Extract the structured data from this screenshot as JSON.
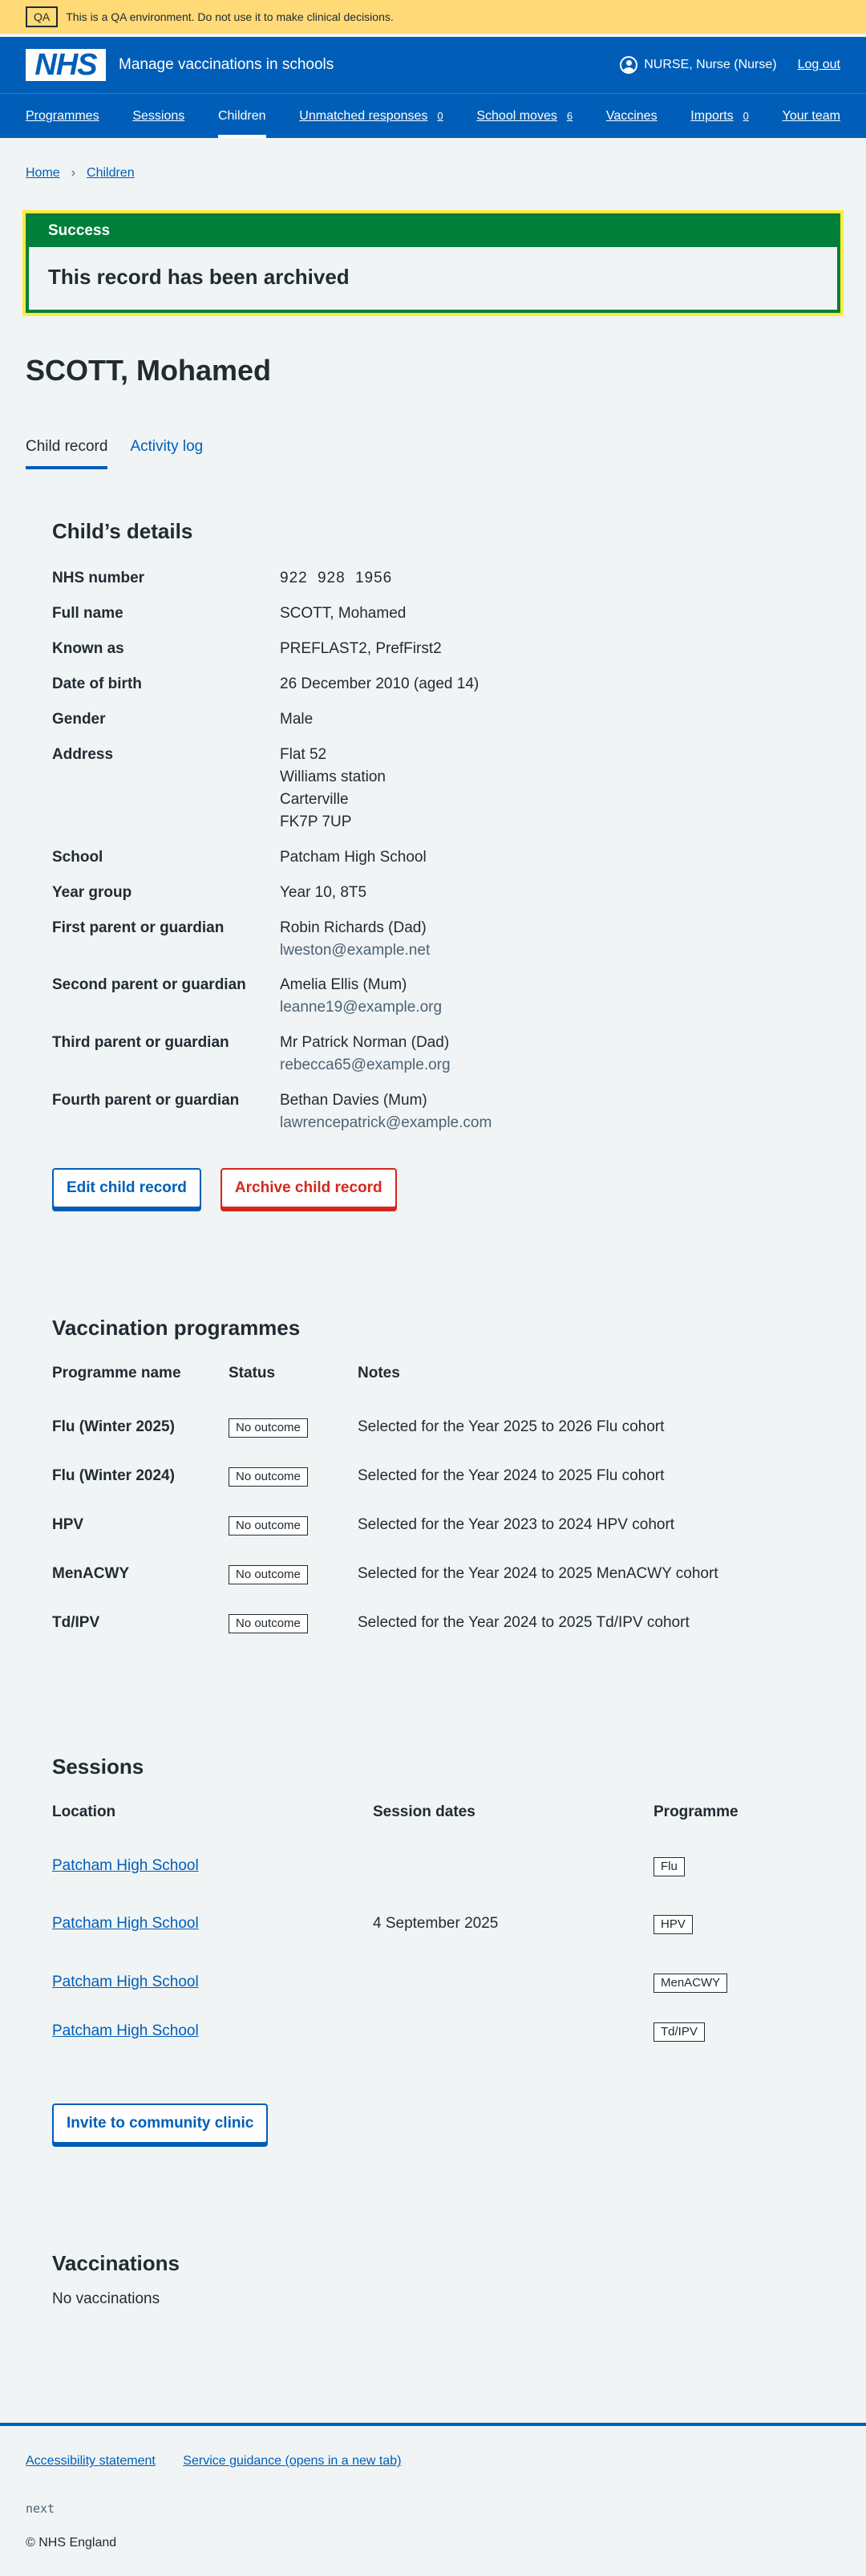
{
  "qa": {
    "tag": "QA",
    "message": "This is a QA environment. Do not use it to make clinical decisions."
  },
  "header": {
    "logo": "NHS",
    "service_name": "Manage vaccinations in schools",
    "user": "NURSE, Nurse (Nurse)",
    "logout": "Log out"
  },
  "nav": [
    {
      "label": "Programmes",
      "count": ""
    },
    {
      "label": "Sessions",
      "count": ""
    },
    {
      "label": "Children",
      "count": ""
    },
    {
      "label": "Unmatched responses",
      "count": "0"
    },
    {
      "label": "School moves",
      "count": "6"
    },
    {
      "label": "Vaccines",
      "count": ""
    },
    {
      "label": "Imports",
      "count": "0"
    },
    {
      "label": "Your team",
      "count": ""
    }
  ],
  "breadcrumb": {
    "home": "Home",
    "children": "Children"
  },
  "success": {
    "heading": "Success",
    "message": "This record has been archived"
  },
  "page_title": "SCOTT, Mohamed",
  "tabs": {
    "child_record": "Child record",
    "activity_log": "Activity log"
  },
  "details": {
    "heading": "Child’s details",
    "rows": [
      {
        "key": "NHS number",
        "value": "922 928 1956"
      },
      {
        "key": "Full name",
        "value": "SCOTT, Mohamed"
      },
      {
        "key": "Known as",
        "value": "PREFLAST2, PrefFirst2"
      },
      {
        "key": "Date of birth",
        "value": "26 December 2010 (aged 14)"
      },
      {
        "key": "Gender",
        "value": "Male"
      },
      {
        "key": "Address",
        "lines": [
          "Flat 52",
          "Williams station",
          "Carterville",
          "FK7P 7UP"
        ]
      },
      {
        "key": "School",
        "value": "Patcham High School"
      },
      {
        "key": "Year group",
        "value": "Year 10, 8T5"
      },
      {
        "key": "First parent or guardian",
        "value": "Robin Richards (Dad)",
        "sub": "lweston@example.net"
      },
      {
        "key": "Second parent or guardian",
        "value": "Amelia Ellis (Mum)",
        "sub": "leanne19@example.org"
      },
      {
        "key": "Third parent or guardian",
        "value": "Mr Patrick Norman (Dad)",
        "sub": "rebecca65@example.org"
      },
      {
        "key": "Fourth parent or guardian",
        "value": "Bethan Davies (Mum)",
        "sub": "lawrencepatrick@example.com"
      }
    ],
    "edit_button": "Edit child record",
    "archive_button": "Archive child record"
  },
  "programmes": {
    "heading": "Vaccination programmes",
    "columns": [
      "Programme name",
      "Status",
      "Notes"
    ],
    "rows": [
      {
        "name": "Flu (Winter 2025)",
        "status": "No outcome",
        "notes": "Selected for the Year 2025 to 2026 Flu cohort"
      },
      {
        "name": "Flu (Winter 2024)",
        "status": "No outcome",
        "notes": "Selected for the Year 2024 to 2025 Flu cohort"
      },
      {
        "name": "HPV",
        "status": "No outcome",
        "notes": "Selected for the Year 2023 to 2024 HPV cohort"
      },
      {
        "name": "MenACWY",
        "status": "No outcome",
        "notes": "Selected for the Year 2024 to 2025 MenACWY cohort"
      },
      {
        "name": "Td/IPV",
        "status": "No outcome",
        "notes": "Selected for the Year 2024 to 2025 Td/IPV cohort"
      }
    ]
  },
  "sessions": {
    "heading": "Sessions",
    "columns": [
      "Location",
      "Session dates",
      "Programme"
    ],
    "rows": [
      {
        "location": "Patcham High School",
        "dates": "",
        "programme": "Flu"
      },
      {
        "location": "Patcham High School",
        "dates": "4 September 2025",
        "programme": "HPV"
      },
      {
        "location": "Patcham High School",
        "dates": "",
        "programme": "MenACWY"
      },
      {
        "location": "Patcham High School",
        "dates": "",
        "programme": "Td/IPV"
      }
    ],
    "invite_button": "Invite to community clinic"
  },
  "vaccinations": {
    "heading": "Vaccinations",
    "empty": "No vaccinations"
  },
  "footer": {
    "accessibility": "Accessibility statement",
    "guidance": "Service guidance (opens in a new tab)",
    "version": "next",
    "copyright": "© NHS England"
  }
}
